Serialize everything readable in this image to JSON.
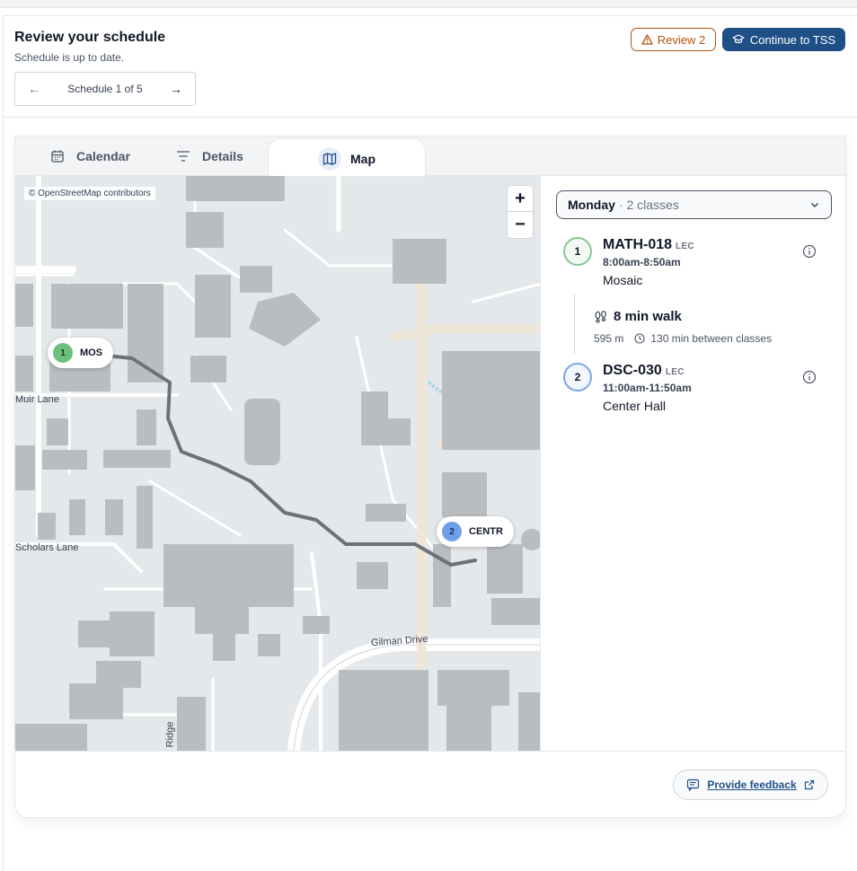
{
  "header": {
    "title": "Review your schedule",
    "subtitle": "Schedule is up to date.",
    "schedule_nav": {
      "label": "Schedule 1 of 5",
      "prev_icon": "arrow-left-icon",
      "next_icon": "arrow-right-icon"
    },
    "review_button": {
      "label": "Review 2",
      "icon": "warning-icon",
      "color": "#b45309"
    },
    "continue_button": {
      "label": "Continue to TSS",
      "icon": "graduation-cap-icon",
      "color": "#1e4f86"
    }
  },
  "tabs": [
    {
      "label": "Calendar",
      "icon": "calendar-icon",
      "active": false
    },
    {
      "label": "Details",
      "icon": "filter-lines-icon",
      "active": false
    },
    {
      "label": "Map",
      "icon": "map-icon",
      "active": true
    }
  ],
  "map": {
    "attribution": "© OpenStreetMap contributors",
    "zoom_in": "+",
    "zoom_out": "−",
    "markers": [
      {
        "number": "1",
        "label": "MOS",
        "color": "#6cbf7c"
      },
      {
        "number": "2",
        "label": "CENTR",
        "color": "#6ea0ea"
      }
    ],
    "roads": [
      "Muir Lane",
      "Scholars Lane",
      "Gilman Drive",
      "Ridge"
    ]
  },
  "panel": {
    "day": "Monday",
    "class_count": "· 2 classes",
    "classes": [
      {
        "number": "1",
        "code": "MATH-018",
        "type": "LEC",
        "time": "8:00am-8:50am",
        "location": "Mosaic"
      },
      {
        "number": "2",
        "code": "DSC-030",
        "type": "LEC",
        "time": "11:00am-11:50am",
        "location": "Center Hall"
      }
    ],
    "walk": {
      "title": "8 min walk",
      "distance": "595 m",
      "between": "130 min between classes"
    }
  },
  "footer": {
    "feedback_label": "Provide feedback"
  }
}
